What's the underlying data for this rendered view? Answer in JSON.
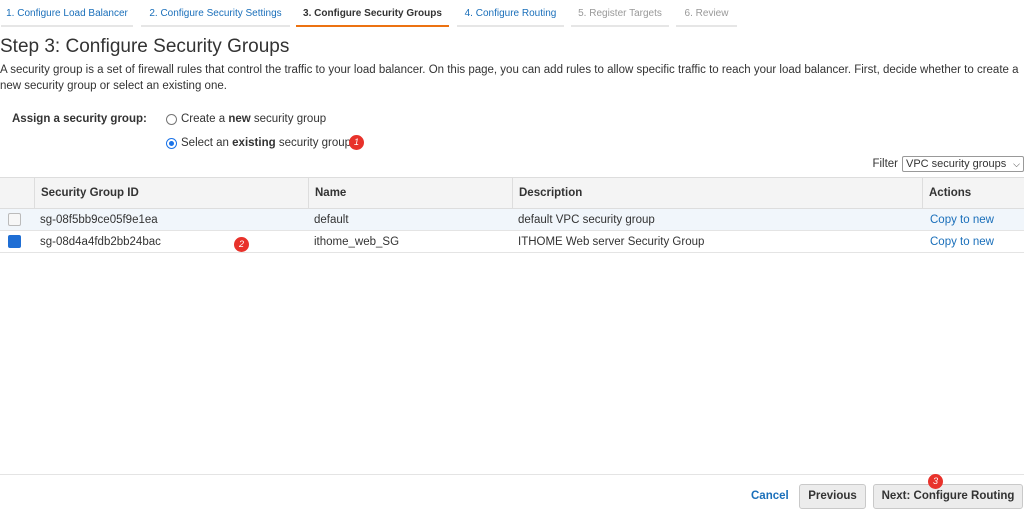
{
  "wizard": {
    "steps": [
      "1. Configure Load Balancer",
      "2. Configure Security Settings",
      "3. Configure Security Groups",
      "4. Configure Routing",
      "5. Register Targets",
      "6. Review"
    ]
  },
  "page": {
    "title": "Step 3: Configure Security Groups",
    "description": "A security group is a set of firewall rules that control the traffic to your load balancer. On this page, you can add rules to allow specific traffic to reach your load balancer. First, decide whether to create a new security group or select an existing one."
  },
  "assign": {
    "label": "Assign a security group:",
    "option_new": {
      "pre": "Create a ",
      "bold": "new",
      "post": " security group",
      "checked": false
    },
    "option_existing": {
      "pre": "Select an ",
      "bold": "existing",
      "post": " security group",
      "checked": true
    }
  },
  "filter": {
    "label": "Filter",
    "value": "VPC security groups"
  },
  "table": {
    "headers": {
      "id": "Security Group ID",
      "name": "Name",
      "description": "Description",
      "actions": "Actions"
    },
    "rows": [
      {
        "id": "sg-08f5bb9ce05f9e1ea",
        "name": "default",
        "description": "default VPC security group",
        "action": "Copy to new",
        "checked": false
      },
      {
        "id": "sg-08d4a4fdb2bb24bac",
        "name": "ithome_web_SG",
        "description": "ITHOME Web server Security Group",
        "action": "Copy to new",
        "checked": true
      }
    ]
  },
  "badges": {
    "one": "1",
    "two": "2",
    "three": "3"
  },
  "footer": {
    "cancel": "Cancel",
    "previous": "Previous",
    "next": "Next: Configure Routing"
  },
  "colors": {
    "accent": "#ec7211",
    "link": "#1a6fba",
    "badge": "#e8322b",
    "checkbox": "#1f6ed4"
  }
}
